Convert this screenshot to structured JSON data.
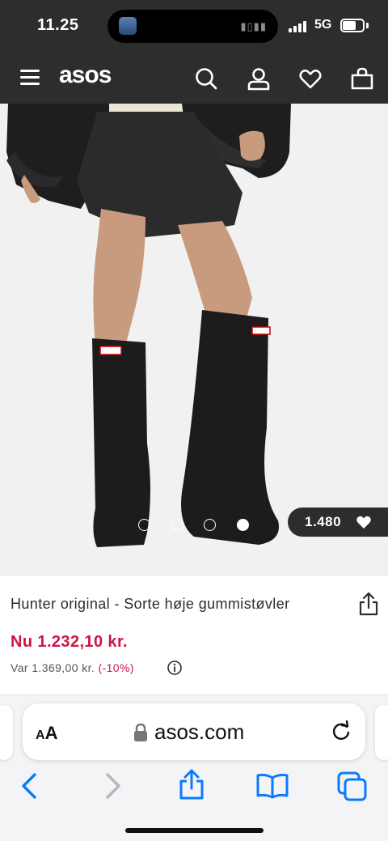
{
  "status_bar": {
    "time": "11.25",
    "network": "5G",
    "battery_level": 0.62
  },
  "header": {
    "logo": "asos",
    "icons": [
      "menu-icon",
      "search-icon",
      "account-icon",
      "heart-icon",
      "bag-icon"
    ]
  },
  "gallery": {
    "image_count": 4,
    "active_index": 3,
    "likes": "1.480"
  },
  "product": {
    "title": "Hunter original - Sorte høje gummistøvler",
    "price": "Nu 1.232,10 kr.",
    "was_label": "Var 1.369,00 kr.",
    "discount": "(-10%)"
  },
  "browser": {
    "aa_label_big": "A",
    "aa_label_small": "A",
    "url": "asos.com",
    "toolbar_icons": [
      "back-icon",
      "forward-icon",
      "share-icon",
      "bookmarks-icon",
      "tabs-icon"
    ]
  },
  "colors": {
    "header_bg": "#2d2d2d",
    "price": "#d01345",
    "safari_blue": "#0a7aff"
  }
}
